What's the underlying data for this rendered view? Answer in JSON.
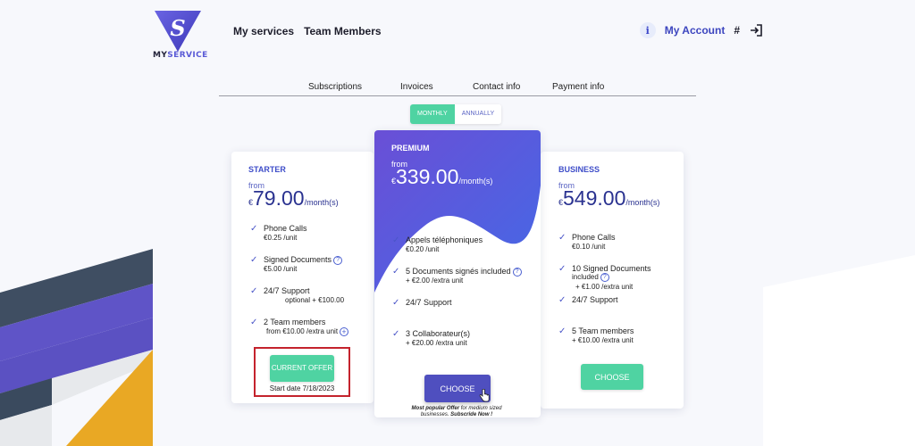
{
  "brand": {
    "logo_letter": "S",
    "name_prefix": "MY",
    "name_suffix": "SERVICE",
    "colors": {
      "primary": "#3d46bf",
      "accent_green": "#4fd3a2",
      "highlight_red": "#c4232d"
    }
  },
  "nav": {
    "items": [
      "My services",
      "Team Members"
    ]
  },
  "account": {
    "info_icon": "i",
    "label": "My Account",
    "hash": "#",
    "logout_icon": "logout-icon"
  },
  "tabs": [
    "Subscriptions",
    "Invoices",
    "Contact info",
    "Payment info"
  ],
  "billing": {
    "monthly": "MONTHLY",
    "annually": "ANNUALLY",
    "selected": "MONTHLY"
  },
  "plans": {
    "starter": {
      "name": "STARTER",
      "from": "from",
      "currency": "€",
      "price": "79.00",
      "period": "/month(s)",
      "features": [
        {
          "title": "Phone Calls",
          "sub": "€0.25 /unit"
        },
        {
          "title": "Signed Documents",
          "sub": "€5.00 /unit"
        },
        {
          "title": "24/7 Support",
          "sub": "optional + €100.00"
        },
        {
          "title": "2 Team members",
          "sub": "from €10.00 /extra unit"
        }
      ],
      "current_label": "CURRENT OFFER",
      "start_date": "Start date 7/18/2023"
    },
    "premium": {
      "name": "PREMIUM",
      "from": "from",
      "currency": "€",
      "price": "339.00",
      "period": "/month(s)",
      "features": [
        {
          "title": "Appels téléphoniques",
          "sub": "€0.20 /unit"
        },
        {
          "title": "5 Documents signés included",
          "sub": "+ €2.00 /extra unit"
        },
        {
          "title": "24/7 Support",
          "sub": ""
        },
        {
          "title": "3 Collaborateur(s)",
          "sub": "+ €20.00 /extra unit"
        }
      ],
      "choose": "CHOOSE",
      "popular_lead": "Most popular Offer",
      "popular_text": " for medium sized businesses. ",
      "popular_cta": "Subscride Now !"
    },
    "business": {
      "name": "BUSINESS",
      "from": "from",
      "currency": "€",
      "price": "549.00",
      "period": "/month(s)",
      "features": [
        {
          "title": "Phone Calls",
          "sub": "€0.10 /unit"
        },
        {
          "title": "10 Signed Documents",
          "title2": "included",
          "sub": "+ €1.00 /extra unit"
        },
        {
          "title": "24/7 Support",
          "sub": ""
        },
        {
          "title": "5 Team members",
          "sub": "+ €10.00 /extra unit"
        }
      ],
      "choose": "CHOOSE"
    }
  },
  "icons": {
    "help": "?",
    "plus": "+",
    "check": "✓"
  }
}
